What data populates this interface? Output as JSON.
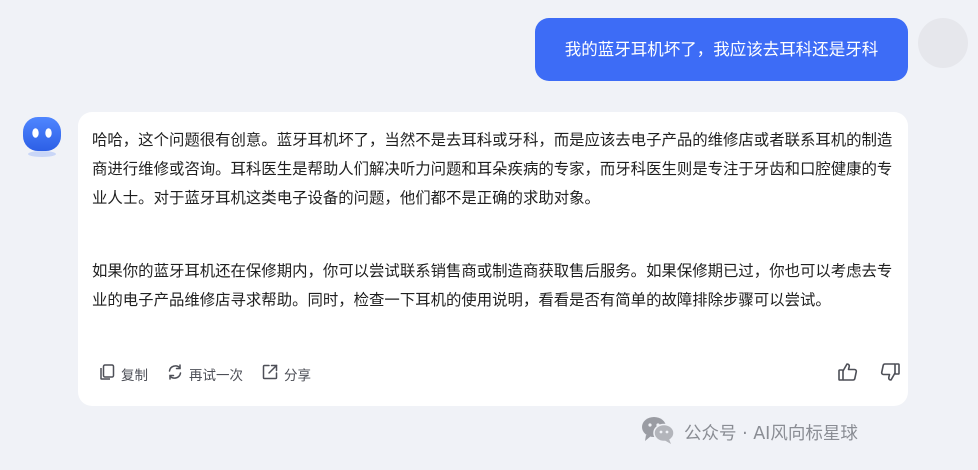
{
  "user_message": {
    "text": "我的蓝牙耳机坏了，我应该去耳科还是牙科"
  },
  "bot_message": {
    "paragraphs": [
      "哈哈，这个问题很有创意。蓝牙耳机坏了，当然不是去耳科或牙科，而是应该去电子产品的维修店或者联系耳机的制造商进行维修或咨询。耳科医生是帮助人们解决听力问题和耳朵疾病的专家，而牙科医生则是专注于牙齿和口腔健康的专业人士。对于蓝牙耳机这类电子设备的问题，他们都不是正确的求助对象。",
      "如果你的蓝牙耳机还在保修期内，你可以尝试联系销售商或制造商获取售后服务。如果保修期已过，你也可以考虑去专业的电子产品维修店寻求帮助。同时，检查一下耳机的使用说明，看看是否有简单的故障排除步骤可以尝试。"
    ],
    "actions": {
      "copy": "复制",
      "retry": "再试一次",
      "share": "分享"
    }
  },
  "watermark": {
    "text": "公众号 · AI风向标星球"
  },
  "colors": {
    "background": "#f0f2f7",
    "user_bubble": "#3d6cf6",
    "bot_card": "#ffffff",
    "bot_avatar": "#3a73f0",
    "user_avatar": "#e6e7ec"
  },
  "icons": {
    "copy": "copy-icon",
    "retry": "refresh-icon",
    "share": "share-icon",
    "like": "thumbs-up-icon",
    "dislike": "thumbs-down-icon",
    "watermark": "wechat-icon"
  }
}
